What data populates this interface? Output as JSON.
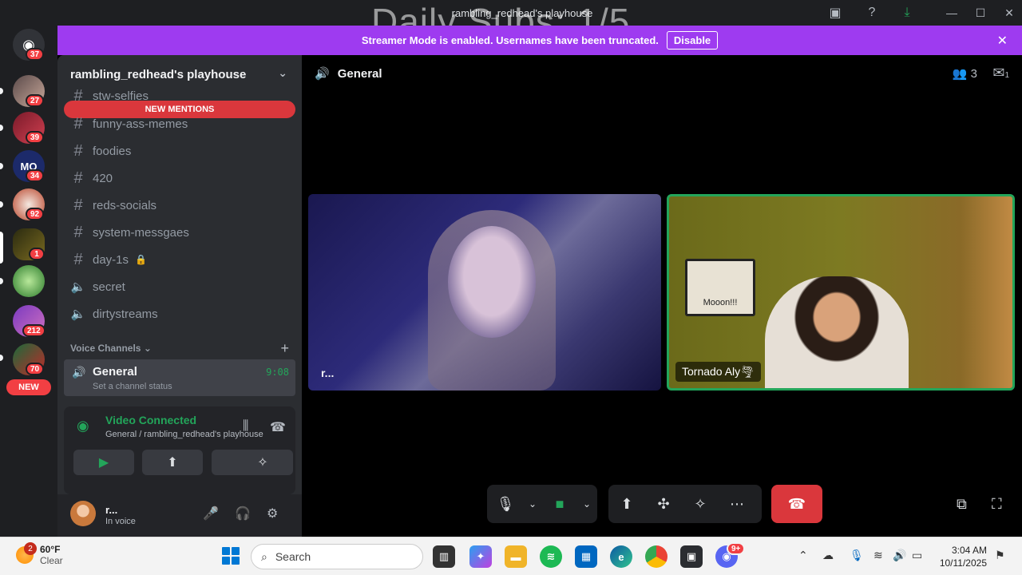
{
  "window": {
    "title": "rambling_redhead's playhouse",
    "overlay": "Daily Subs: 1/5"
  },
  "banner": {
    "text": "Streamer Mode is enabled. Usernames have been truncated.",
    "disable": "Disable"
  },
  "rail": {
    "badges": [
      "37",
      "27",
      "39",
      "34",
      "92",
      "1",
      "212",
      "70"
    ],
    "new_label": "NEW"
  },
  "server": {
    "name": "rambling_redhead's playhouse",
    "new_mentions": "NEW MENTIONS",
    "channels": [
      {
        "name": "stw-selfies",
        "kind": "text"
      },
      {
        "name": "funny-ass-memes",
        "kind": "text"
      },
      {
        "name": "foodies",
        "kind": "text"
      },
      {
        "name": "420",
        "kind": "text"
      },
      {
        "name": "reds-socials",
        "kind": "text"
      },
      {
        "name": "system-messgaes",
        "kind": "text"
      },
      {
        "name": "day-1s",
        "kind": "text"
      },
      {
        "name": "secret",
        "kind": "voice"
      },
      {
        "name": "dirtystreams",
        "kind": "voice"
      }
    ],
    "voice_category": "Voice Channels",
    "voice_channel": {
      "name": "General",
      "status": "Set a channel status",
      "timer": "9:08"
    }
  },
  "rtc": {
    "state": "Video Connected",
    "location": "General / rambling_redhead's playhouse"
  },
  "user": {
    "name": "r...",
    "status": "In voice"
  },
  "main": {
    "channel": "General",
    "participants": "3",
    "inbox_count": "1",
    "tiles": [
      {
        "label": "r..."
      },
      {
        "label": "Tornado Aly🌪"
      }
    ],
    "whiteboard_text": "Mooon!!!"
  },
  "taskbar": {
    "weather_badge": "2",
    "temp": "60°F",
    "condition": "Clear",
    "search_placeholder": "Search",
    "time": "3:04 AM",
    "date": "10/11/2025",
    "discord_badge": "9+"
  },
  "colors": {
    "banner": "#9e3bf0",
    "connected": "#23a55a",
    "danger": "#da373c"
  }
}
